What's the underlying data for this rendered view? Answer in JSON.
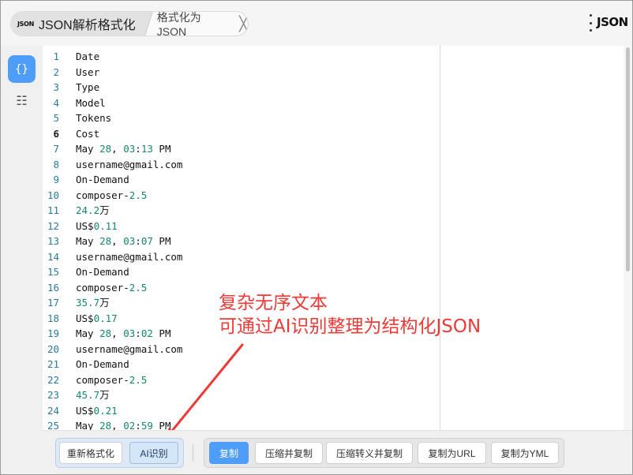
{
  "tabs": {
    "active_logo": "JSON",
    "active_label": "JSON解析格式化",
    "inactive_label": "格式化为 JSON",
    "close_symbol": "╳"
  },
  "header": {
    "logo": "JSON"
  },
  "sidebar": {
    "active_icon": "{}",
    "list_icon": "☷"
  },
  "editor": {
    "current_line": 6,
    "lines": [
      [
        {
          "t": "Date"
        }
      ],
      [
        {
          "t": "User"
        }
      ],
      [
        {
          "t": "Type"
        }
      ],
      [
        {
          "t": "Model"
        }
      ],
      [
        {
          "t": "Tokens"
        }
      ],
      [
        {
          "t": "Cost"
        }
      ],
      [
        {
          "t": "May "
        },
        {
          "t": "28",
          "n": 1
        },
        {
          "t": ", "
        },
        {
          "t": "03",
          "n": 1
        },
        {
          "t": ":"
        },
        {
          "t": "13",
          "n": 1
        },
        {
          "t": " PM"
        }
      ],
      [
        {
          "t": "username@gmail.com"
        }
      ],
      [
        {
          "t": "On-Demand"
        }
      ],
      [
        {
          "t": "composer-"
        },
        {
          "t": "2.5",
          "n": 1
        }
      ],
      [
        {
          "t": "24.2",
          "n": 1
        },
        {
          "t": "万"
        }
      ],
      [
        {
          "t": "US$"
        },
        {
          "t": "0.11",
          "n": 1
        }
      ],
      [
        {
          "t": "May "
        },
        {
          "t": "28",
          "n": 1
        },
        {
          "t": ", "
        },
        {
          "t": "03",
          "n": 1
        },
        {
          "t": ":"
        },
        {
          "t": "07",
          "n": 1
        },
        {
          "t": " PM"
        }
      ],
      [
        {
          "t": "username@gmail.com"
        }
      ],
      [
        {
          "t": "On-Demand"
        }
      ],
      [
        {
          "t": "composer-"
        },
        {
          "t": "2.5",
          "n": 1
        }
      ],
      [
        {
          "t": "35.7",
          "n": 1
        },
        {
          "t": "万"
        }
      ],
      [
        {
          "t": "US$"
        },
        {
          "t": "0.17",
          "n": 1
        }
      ],
      [
        {
          "t": "May "
        },
        {
          "t": "28",
          "n": 1
        },
        {
          "t": ", "
        },
        {
          "t": "03",
          "n": 1
        },
        {
          "t": ":"
        },
        {
          "t": "02",
          "n": 1
        },
        {
          "t": " PM"
        }
      ],
      [
        {
          "t": "username@gmail.com"
        }
      ],
      [
        {
          "t": "On-Demand"
        }
      ],
      [
        {
          "t": "composer-"
        },
        {
          "t": "2.5",
          "n": 1
        }
      ],
      [
        {
          "t": "45.7",
          "n": 1
        },
        {
          "t": "万"
        }
      ],
      [
        {
          "t": "US$"
        },
        {
          "t": "0.21",
          "n": 1
        }
      ],
      [
        {
          "t": "May "
        },
        {
          "t": "28",
          "n": 1
        },
        {
          "t": ", "
        },
        {
          "t": "02",
          "n": 1
        },
        {
          "t": ":"
        },
        {
          "t": "59",
          "n": 1
        },
        {
          "t": " PM"
        }
      ]
    ]
  },
  "annotation": {
    "line1": "复杂无序文本",
    "line2": "可通过AI识别整理为结构化JSON",
    "color": "#ee3a37"
  },
  "toolbar": {
    "reformat": "重新格式化",
    "ai_recognize": "AI识别",
    "copy": "复制",
    "compress_copy": "压缩并复制",
    "compress_escape_copy": "压缩转义并复制",
    "copy_url": "复制为URL",
    "copy_yml": "复制为YML"
  },
  "colors": {
    "accent": "#4e9ef7",
    "number": "#14876f",
    "line_number": "#2a7a9a"
  }
}
